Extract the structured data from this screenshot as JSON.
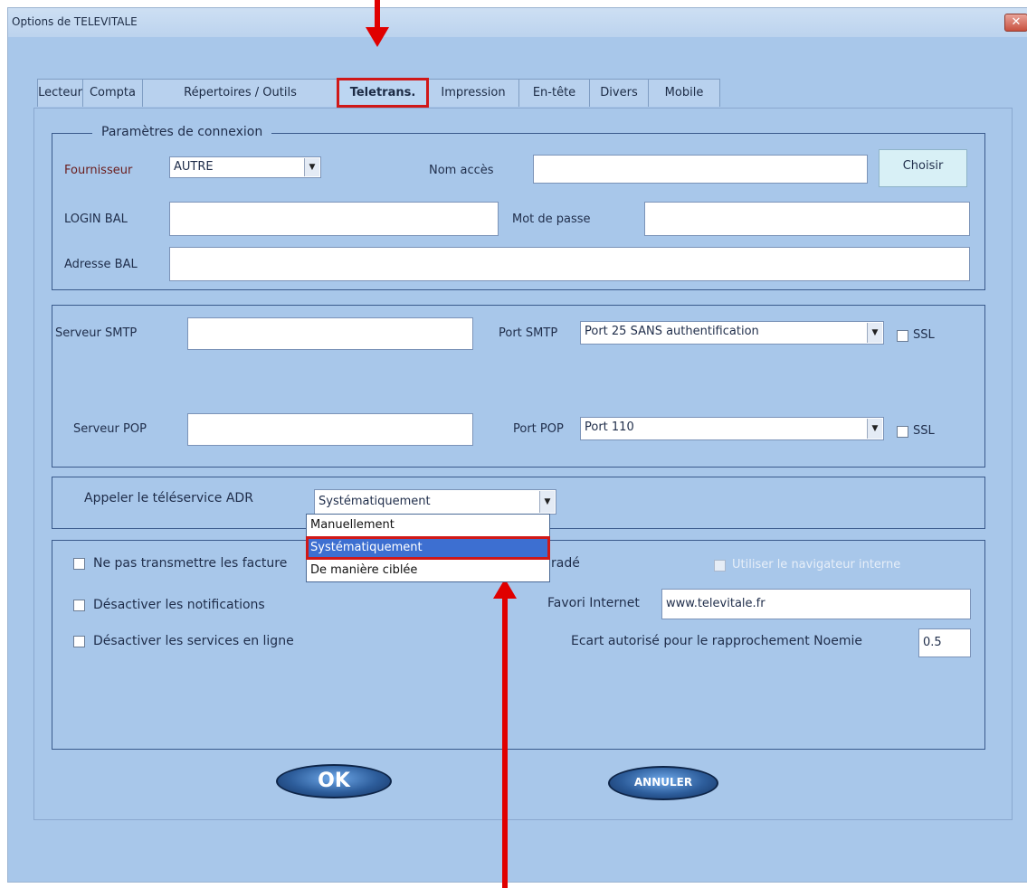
{
  "window": {
    "title": "Options de TELEVITALE",
    "close_label": "✕"
  },
  "tabs": [
    {
      "label": "Lecteur"
    },
    {
      "label": "Compta"
    },
    {
      "label": "Répertoires / Outils"
    },
    {
      "label": "Teletrans.",
      "active": true
    },
    {
      "label": "Impression"
    },
    {
      "label": "En-tête"
    },
    {
      "label": "Divers"
    },
    {
      "label": "Mobile"
    }
  ],
  "connexion": {
    "legend": "Paramètres de connexion",
    "fournisseur_label": "Fournisseur",
    "fournisseur_value": "AUTRE",
    "nom_acces_label": "Nom accès",
    "nom_acces_value": "",
    "choisir_label": "Choisir",
    "login_label": "LOGIN BAL",
    "login_value": "",
    "mot_de_passe_label": "Mot de passe",
    "mot_de_passe_value": "",
    "adresse_label": "Adresse BAL",
    "adresse_value": ""
  },
  "servers": {
    "smtp_label": "Serveur SMTP",
    "smtp_value": "",
    "port_smtp_label": "Port SMTP",
    "port_smtp_value": "Port 25 SANS authentification",
    "smtp_ssl_label": "SSL",
    "pop_label": "Serveur POP",
    "pop_value": "",
    "port_pop_label": "Port POP",
    "port_pop_value": "Port 110",
    "pop_ssl_label": "SSL"
  },
  "adr": {
    "label": "Appeler le téléservice ADR",
    "value": "Systématiquement",
    "options": [
      "Manuellement",
      "Systématiquement",
      "De manière ciblée"
    ],
    "selected_index": 1
  },
  "options": {
    "no_transmit_label": "Ne pas transmettre les facture",
    "no_transmit_suffix": "radé",
    "disable_notifications_label": "Désactiver les notifications",
    "disable_online_label": "Désactiver les services en ligne",
    "internal_browser_label": "Utiliser le navigateur interne",
    "favori_label": "Favori Internet",
    "favori_value": "www.televitale.fr",
    "ecart_label": "Ecart autorisé pour le rapprochement Noemie",
    "ecart_value": "0.5"
  },
  "buttons": {
    "ok_label": "OK",
    "cancel_label": "ANNULER"
  },
  "colors": {
    "annotation_red": "#e00000",
    "panel_bg": "#a8c7ea",
    "selection_blue": "#3d6fd1"
  }
}
